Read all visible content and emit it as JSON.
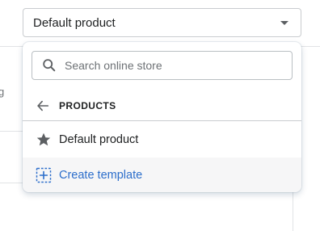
{
  "background": {
    "text_fragment": "g"
  },
  "select": {
    "value": "Default product"
  },
  "popover": {
    "search": {
      "placeholder": "Search online store",
      "value": ""
    },
    "back": {
      "label": "PRODUCTS",
      "icon": "arrow-left-icon"
    },
    "items": [
      {
        "label": "Default product",
        "icon": "star-icon"
      },
      {
        "label": "Create template",
        "icon": "add-template-icon"
      }
    ]
  },
  "colors": {
    "text": "#202223",
    "link": "#2c6ecb",
    "icon": "#5c5f62",
    "hover_bg": "#f6f6f7",
    "border": "#c9cccf"
  }
}
